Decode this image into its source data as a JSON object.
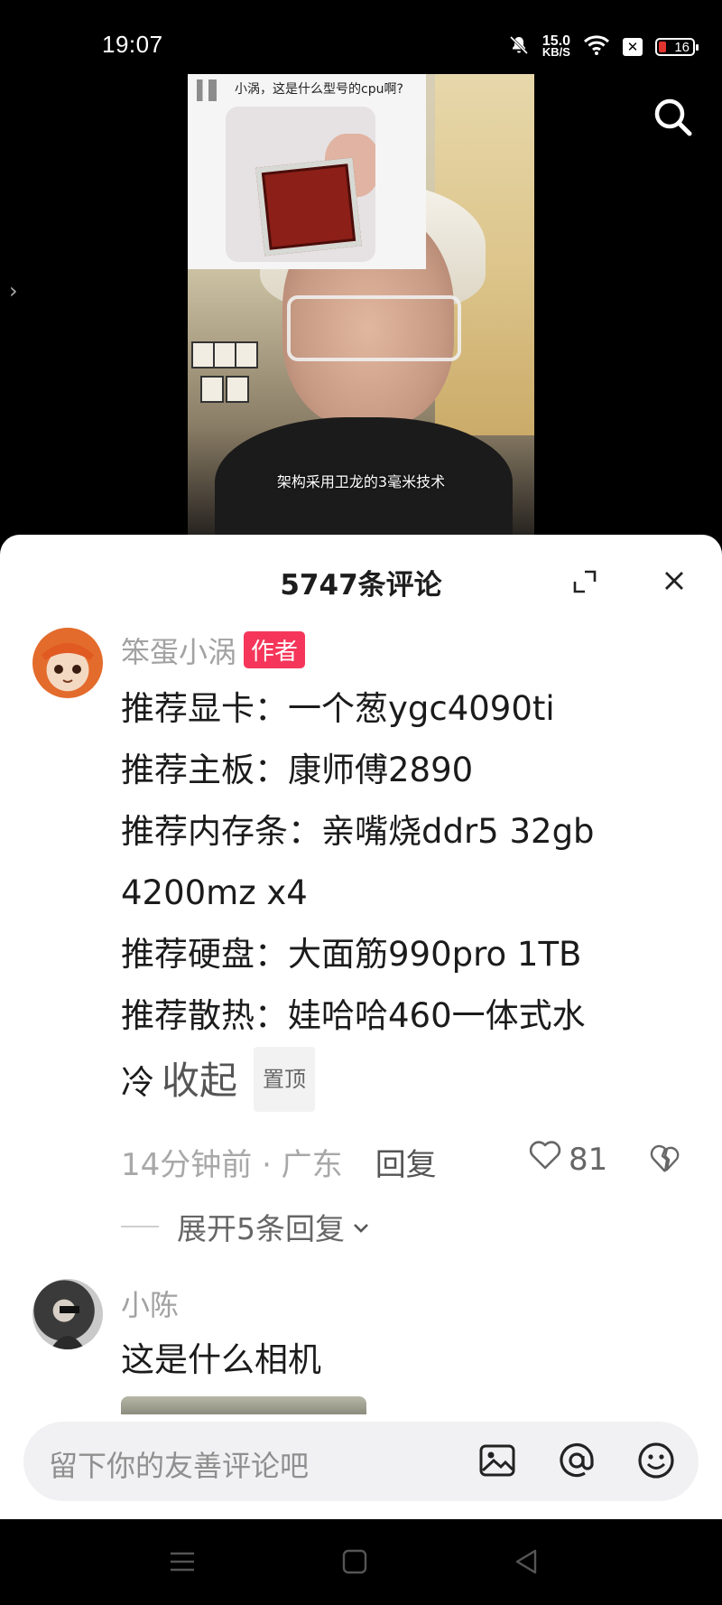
{
  "status_bar": {
    "time": "19:07",
    "speed_value": "15.0",
    "speed_unit": "KB/S",
    "battery": "16",
    "icons": [
      "mute-icon",
      "wifi-icon",
      "x-icon",
      "battery-icon"
    ]
  },
  "video": {
    "question_card_text": "小涡，这是什么型号的cpu啊?",
    "subtitle": "架构采用卫龙的3毫米技术"
  },
  "comments_panel": {
    "title": "5747条评论"
  },
  "comments": [
    {
      "author": "笨蛋小涡",
      "badge": "作者",
      "lines": [
        "推荐显卡：一个葱ygc4090ti",
        "推荐主板：康师傅2890",
        "推荐内存条：亲嘴烧ddr5 32gb",
        "4200mz x4",
        "推荐硬盘：大面筋990pro 1TB",
        "推荐散热：娃哈哈460一体式水",
        "冷"
      ],
      "collapse_label": "收起",
      "pinned_label": "置顶",
      "time_location": "14分钟前 · 广东",
      "reply_label": "回复",
      "likes": "81",
      "expand_replies": "展开5条回复"
    },
    {
      "author": "小陈",
      "text": "这是什么相机"
    }
  ],
  "input_bar": {
    "placeholder": "留下你的友善评论吧"
  }
}
